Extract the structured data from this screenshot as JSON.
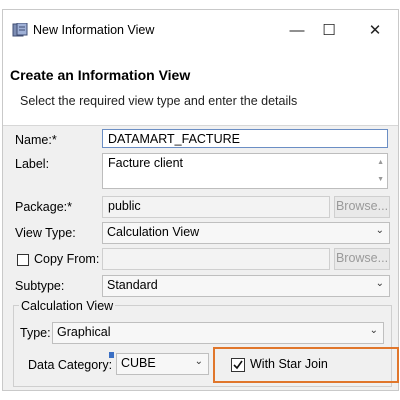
{
  "window": {
    "title": "New Information View",
    "icons": {
      "app": "info-view-icon",
      "minimize": "minimize-icon",
      "maximize": "maximize-icon",
      "close": "close-icon"
    },
    "minimize_glyph": "—",
    "maximize_glyph": "☐",
    "close_glyph": "✕"
  },
  "header": {
    "title": "Create an Information View",
    "subtitle": "Select the required view type and enter the details"
  },
  "form": {
    "name_label": "Name:*",
    "name_value": "DATAMART_FACTURE",
    "label_label": "Label:",
    "label_value": "Facture client",
    "package_label": "Package:*",
    "package_value": "public",
    "package_browse": "Browse...",
    "view_type_label": "View Type:",
    "view_type_value": "Calculation View",
    "copy_from_label": "Copy From:",
    "copy_from_checked": false,
    "copy_from_value": "",
    "copy_from_browse": "Browse...",
    "subtype_label": "Subtype:",
    "subtype_value": "Standard"
  },
  "calc_view": {
    "group_label": "Calculation View",
    "type_label": "Type:",
    "type_value": "Graphical",
    "data_category_label": "Data Category:",
    "data_category_value": "CUBE",
    "star_join_label": "With Star Join",
    "star_join_checked": true
  },
  "colors": {
    "highlight": "#e0762b",
    "focus_border": "#6b8ec4"
  }
}
